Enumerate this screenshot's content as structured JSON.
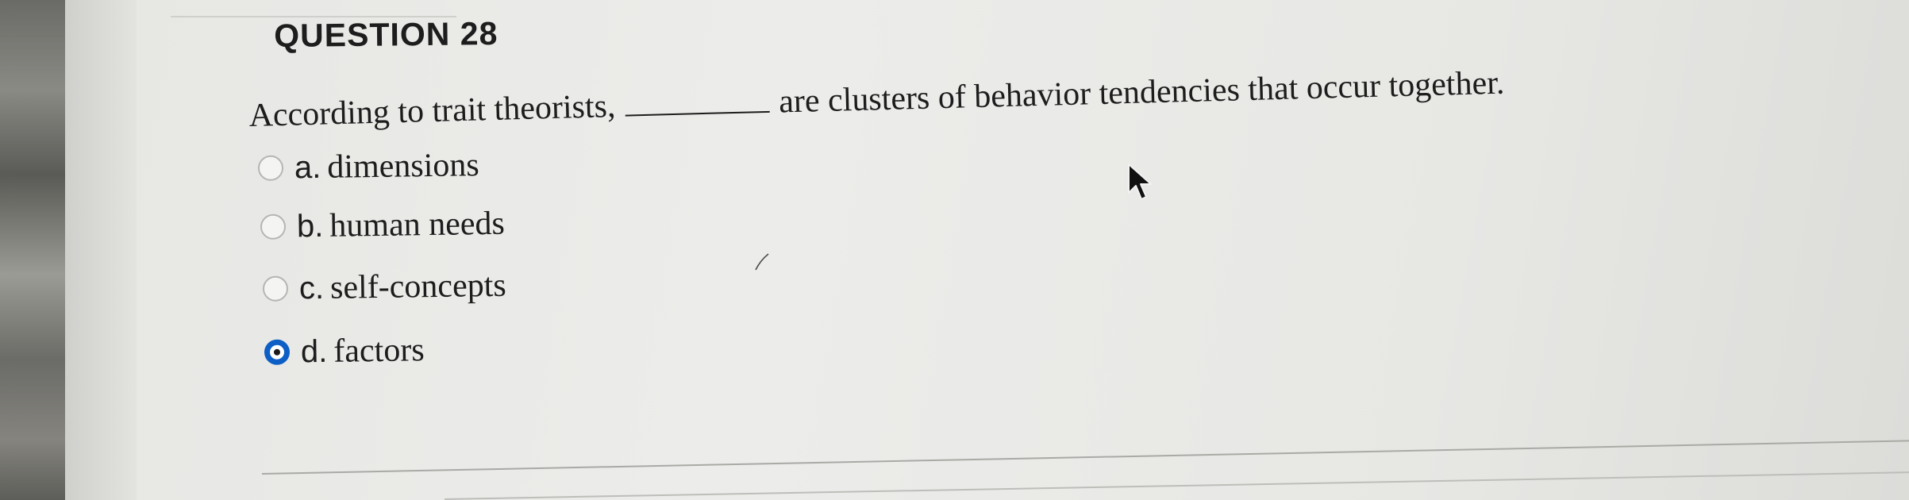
{
  "question": {
    "title": "QUESTION 28",
    "stem_before": "According to trait theorists,",
    "stem_after": "are clusters of behavior tendencies that occur together."
  },
  "options": [
    {
      "letter": "a.",
      "text": "dimensions",
      "selected": false
    },
    {
      "letter": "b.",
      "text": "human needs",
      "selected": false
    },
    {
      "letter": "c.",
      "text": "self-concepts",
      "selected": false
    },
    {
      "letter": "d.",
      "text": "factors",
      "selected": true
    }
  ],
  "colors": {
    "selected_radio": "#0d5fc6",
    "text": "#1d1d1d"
  },
  "icons": {
    "cursor": "mouse-pointer-icon"
  }
}
